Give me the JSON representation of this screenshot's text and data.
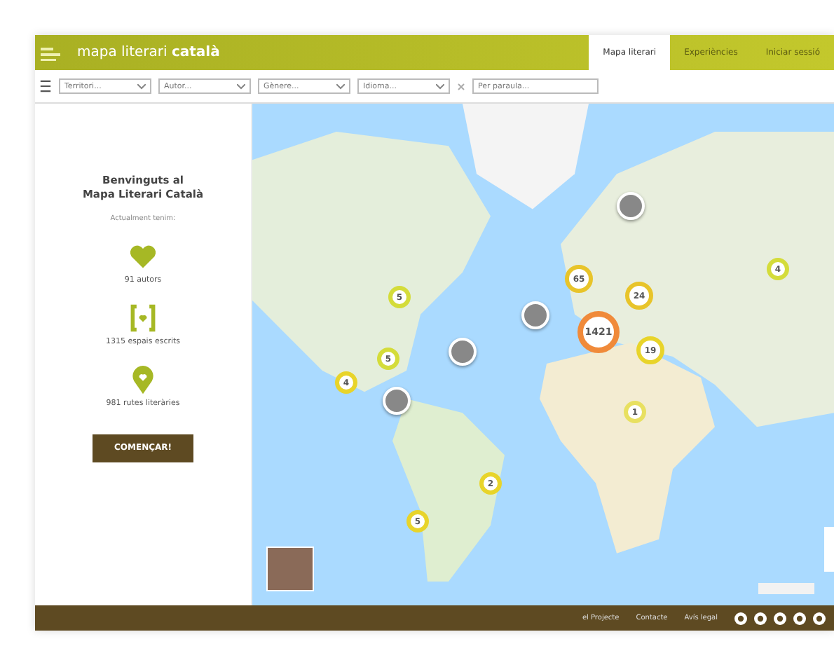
{
  "header": {
    "title": "mapa literari **català**"
  },
  "tabs": [
    {
      "label": "Mapa literari",
      "selected": true
    },
    {
      "label": "Experiències",
      "selected": false
    },
    {
      "label": "Iniciar sessió",
      "selected": false
    }
  ],
  "filters": [
    {
      "placeholder": "Territori..."
    },
    {
      "placeholder": "Autor..."
    },
    {
      "placeholder": "Gènere..."
    },
    {
      "placeholder": "Idioma..."
    }
  ],
  "search": {
    "placeholder": "Per paraula..."
  },
  "sidebar": {
    "title": "Benvinguts al",
    "subtitle": "Mapa Literari Català",
    "intro": "Actualment tenim:",
    "stats": [
      {
        "kind": "heart",
        "text": "91 autors"
      },
      {
        "kind": "book",
        "text": "1315 espais escrits"
      },
      {
        "kind": "pin",
        "text": "981 rutes literàries"
      }
    ],
    "button": "COMENÇAR!"
  },
  "map": {
    "clusters": [
      {
        "count": "5",
        "color": "#d4dc3a"
      },
      {
        "count": "65",
        "color": "#e8c42a"
      },
      {
        "count": "24",
        "color": "#e8c42a"
      },
      {
        "count": "1421",
        "color": "#f08a3a"
      },
      {
        "count": "19",
        "color": "#e8d42a"
      },
      {
        "count": "4",
        "color": "#d4dc3a"
      },
      {
        "count": "5",
        "color": "#d4dc3a"
      },
      {
        "count": "4",
        "color": "#e8d42a"
      },
      {
        "count": "1",
        "color": "#e8e060"
      },
      {
        "count": "2",
        "color": "#e8d42a"
      },
      {
        "count": "5",
        "color": "#e8d42a"
      }
    ]
  },
  "footer": {
    "links": [
      "el Projecte",
      "Contacte",
      "Avís legal"
    ]
  }
}
